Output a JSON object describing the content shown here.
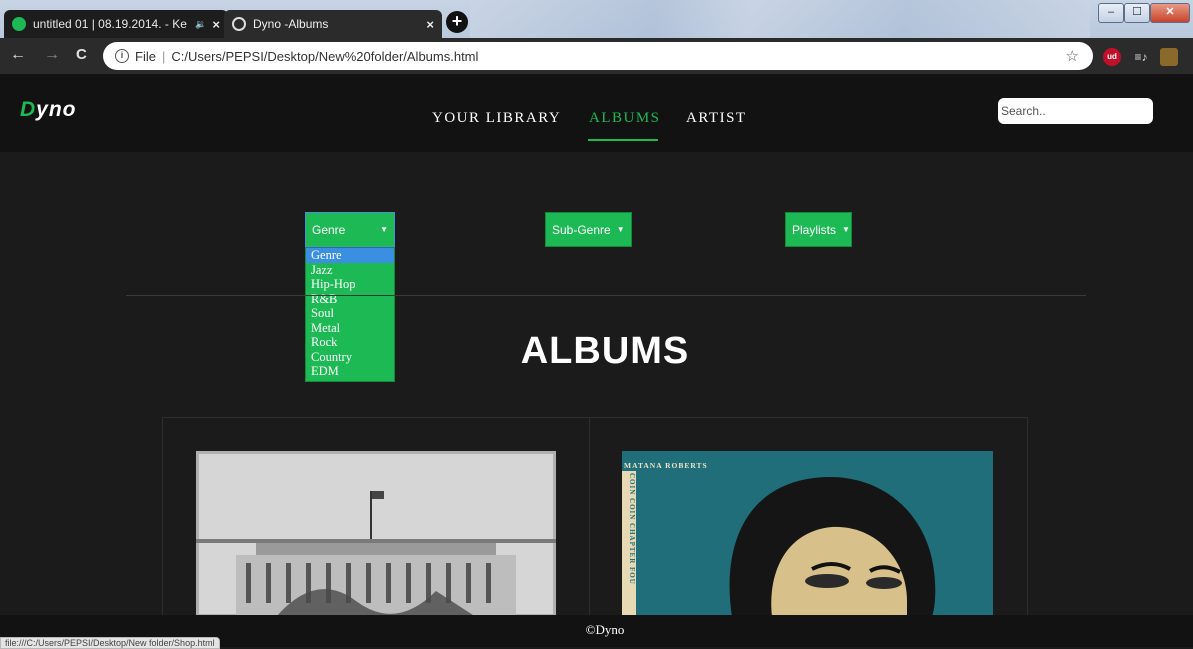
{
  "browser": {
    "tabs": [
      {
        "title": "untitled 01 | 08.19.2014. - Ke",
        "favicon": "spotify-icon",
        "active": false,
        "close": "×",
        "audio": "🔉"
      },
      {
        "title": "Dyno -Albums",
        "favicon": "globe-icon",
        "active": true,
        "close": "×"
      }
    ],
    "new_tab": "+",
    "window_controls": {
      "minimize": "‒",
      "maximize": "☐",
      "close": "✕"
    },
    "nav": {
      "back": "←",
      "forward": "→",
      "reload": "C"
    },
    "address": {
      "scheme_label": "File",
      "url": "C:/Users/PEPSI/Desktop/New%20folder/Albums.html",
      "info": "i",
      "bookmark": "☆"
    },
    "extensions": [
      "ud",
      "≡♪",
      "puzzle"
    ],
    "status_url": "file:///C:/Users/PEPSI/Desktop/New folder/Shop.html"
  },
  "site": {
    "logo": {
      "first": "D",
      "rest": "yno"
    },
    "nav": [
      {
        "label": "YOUR LIBRARY",
        "active": false
      },
      {
        "label": "ALBUMS",
        "active": true
      },
      {
        "label": "ARTIST",
        "active": false
      }
    ],
    "search_placeholder": "Search.."
  },
  "filters": {
    "genre": {
      "selected": "Genre",
      "options": [
        "Genre",
        "Jazz",
        "Hip-Hop",
        "R&B",
        "Soul",
        "Metal",
        "Rock",
        "Country",
        "EDM"
      ],
      "arrow": "▼"
    },
    "sub_genre": {
      "selected": "Sub-Genre",
      "arrow": "▼"
    },
    "playlists": {
      "selected": "Playlists",
      "arrow": "▼"
    }
  },
  "main": {
    "title": "ALBUMS",
    "albums": [
      {
        "cover_text": ""
      },
      {
        "cover_text": "MATANA ROBERTS",
        "spine_text": "COIN COIN CHAPTER FOU"
      }
    ]
  },
  "footer": {
    "copyright": "©Dyno"
  },
  "colors": {
    "accent": "#1db954",
    "header_bg": "#121212",
    "page_bg": "#1b1b1b",
    "selected_option": "#3b8fe0"
  }
}
